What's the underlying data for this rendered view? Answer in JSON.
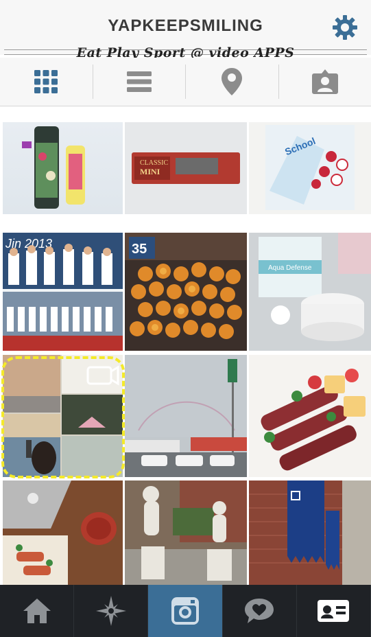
{
  "header": {
    "title": "YAPKEEPSMILING"
  },
  "caption": "Eat Play Sport @ video APPS",
  "view_options": [
    "grid-view",
    "list-view",
    "map-view",
    "tagged-view"
  ],
  "tabs": [
    "home",
    "explore",
    "camera",
    "activity",
    "profile"
  ],
  "photos": [
    {
      "subject": "tumbler-and-snack"
    },
    {
      "subject": "classic-mini-box"
    },
    {
      "subject": "candy-bag"
    },
    {
      "subject": "team-photo"
    },
    {
      "subject": "pumpkins"
    },
    {
      "subject": "skincare-jar"
    },
    {
      "subject": "video-collage"
    },
    {
      "subject": "rainbow-street"
    },
    {
      "subject": "bacon-skewers"
    },
    {
      "subject": "laptop-cafe"
    },
    {
      "subject": "garden-statues"
    },
    {
      "subject": "brick-building-banner"
    }
  ],
  "colors": {
    "accent": "#3b6e96",
    "tabbar": "#1f2226",
    "highlight": "#f4ea2a"
  }
}
